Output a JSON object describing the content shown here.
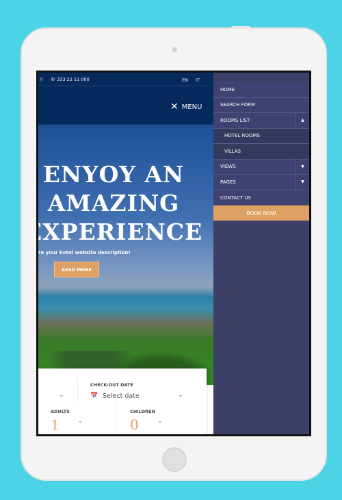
{
  "topbar": {
    "phone": "333 22 11 000",
    "languages": [
      "EN",
      "IT"
    ]
  },
  "header": {
    "menu_label": "MENU"
  },
  "hero": {
    "title_lines": [
      "ENYOY AN",
      "AMAZING",
      "EXPERIENCE"
    ],
    "description": "re your hotel website description!",
    "button": "READ MORE"
  },
  "booking": {
    "checkout_label": "CHECK-OUT DATE",
    "checkout_placeholder": "Select date",
    "adults_label": "ADULTS",
    "adults_value": "1",
    "children_label": "CHILDREN",
    "children_value": "0"
  },
  "menu": {
    "items": [
      {
        "label": "HOME"
      },
      {
        "label": "SEARCH FORM"
      },
      {
        "label": "ROOMS LIST",
        "toggle": "▲"
      },
      {
        "label": "HOTEL ROOMS"
      },
      {
        "label": "VILLAS"
      },
      {
        "label": "VIEWS",
        "toggle": "▼"
      },
      {
        "label": "PAGES",
        "toggle": "▼"
      },
      {
        "label": "CONTACT US"
      }
    ],
    "book_now": "BOOK NOW"
  },
  "colors": {
    "accent": "#dea163",
    "menu_bg": "#3c3f66",
    "header_bg": "#062a5e",
    "background": "#4dd3e6"
  }
}
